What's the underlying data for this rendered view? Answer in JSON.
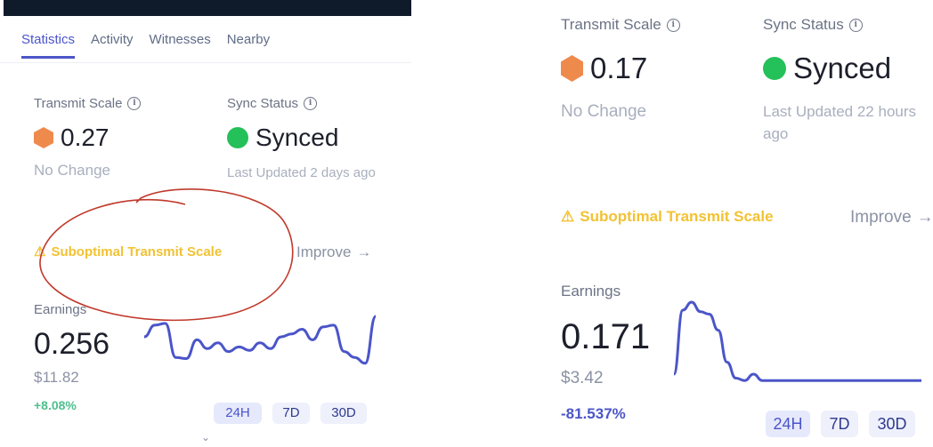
{
  "left": {
    "tabs": [
      "Statistics",
      "Activity",
      "Witnesses",
      "Nearby"
    ],
    "active_tab": "Statistics",
    "transmit": {
      "label": "Transmit Scale",
      "value": "0.27",
      "note": "No Change",
      "info_icon": "info-icon",
      "shape_icon": "hexagon-icon"
    },
    "sync": {
      "label": "Sync Status",
      "value": "Synced",
      "note": "Last Updated 2 days ago",
      "status_icon": "green-dot-icon"
    },
    "warning": {
      "icon": "warning-icon",
      "text": "Suboptimal Transmit Scale"
    },
    "improve": {
      "label": "Improve",
      "arrow": "→"
    },
    "earnings": {
      "label": "Earnings",
      "value": "0.256",
      "usd": "$11.82",
      "change": "+8.08%",
      "sparkline": [
        0.35,
        0.15,
        0.12,
        0.7,
        0.72,
        0.4,
        0.55,
        0.45,
        0.6,
        0.52,
        0.58,
        0.45,
        0.55,
        0.35,
        0.3,
        0.22,
        0.4,
        0.18,
        0.15,
        0.6,
        0.7,
        0.8,
        0.0
      ]
    },
    "ranges": [
      "24H",
      "7D",
      "30D"
    ],
    "chevron": "chevron-down-icon"
  },
  "right": {
    "transmit": {
      "label": "Transmit Scale",
      "value": "0.17",
      "note": "No Change",
      "info_icon": "info-icon",
      "shape_icon": "hexagon-icon"
    },
    "sync": {
      "label": "Sync Status",
      "value": "Synced",
      "note": "Last Updated 22 hours ago",
      "status_icon": "green-dot-icon"
    },
    "warning": {
      "icon": "warning-icon",
      "text": "Suboptimal Transmit Scale"
    },
    "improve": {
      "label": "Improve",
      "arrow": "→"
    },
    "earnings": {
      "label": "Earnings",
      "value": "0.171",
      "usd": "$3.42",
      "change": "-81.537%",
      "sparkline": [
        0.9,
        0.1,
        0.0,
        0.12,
        0.15,
        0.35,
        0.75,
        0.95,
        0.98,
        0.9,
        0.98,
        0.98,
        0.98,
        0.98,
        0.98,
        0.98,
        0.98,
        0.98,
        0.98,
        0.98,
        0.98,
        0.98,
        0.98,
        0.98,
        0.98,
        0.98,
        0.98,
        0.98,
        0.98
      ]
    },
    "ranges": [
      "24H",
      "7D",
      "30D"
    ]
  },
  "colors": {
    "accent": "#4b55c9",
    "hexagon": "#ef8a4d",
    "synced": "#24c05a",
    "warning": "#f2c233",
    "positive": "#4fc08d",
    "annotation": "#c0392b"
  }
}
